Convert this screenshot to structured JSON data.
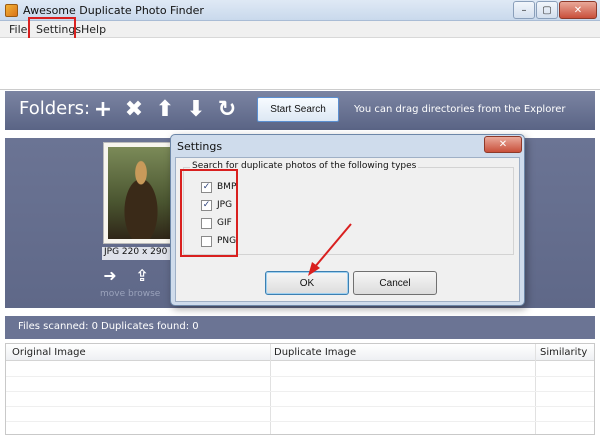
{
  "app": {
    "title": "Awesome Duplicate Photo Finder"
  },
  "window_controls": {
    "minimize": "–",
    "maximize": "▢",
    "close": "✕"
  },
  "menu": {
    "file": "File",
    "settings": "Settings",
    "help": "Help"
  },
  "toolbar": {
    "folders_label": "Folders:",
    "icons": [
      "plus-icon",
      "cross-icon",
      "arrow-up-icon",
      "arrow-down-icon",
      "refresh-icon"
    ],
    "start_search": "Start Search",
    "hint": "You can drag directories from the Explorer"
  },
  "preview": {
    "photo_info": "JPG  220 x 290  17",
    "actions": [
      {
        "icon": "arrow-right-icon",
        "label": "move"
      },
      {
        "icon": "upload-icon",
        "label": "browse"
      }
    ]
  },
  "status": {
    "files_scanned": "Files scanned: 0",
    "duplicates_found": "Duplicates found: 0"
  },
  "grid": {
    "columns": [
      "Original Image",
      "Duplicate Image",
      "Similarity"
    ]
  },
  "dialog": {
    "title": "Settings",
    "group_label": "Search for duplicate photos of the following types",
    "types": [
      {
        "label": "BMP",
        "checked": true
      },
      {
        "label": "JPG",
        "checked": true
      },
      {
        "label": "GIF",
        "checked": false
      },
      {
        "label": "PNG",
        "checked": false
      }
    ],
    "ok": "OK",
    "cancel": "Cancel"
  },
  "colors": {
    "highlight": "#d9201f",
    "panel": "#6b7494",
    "accent": "#5b8fd1"
  }
}
